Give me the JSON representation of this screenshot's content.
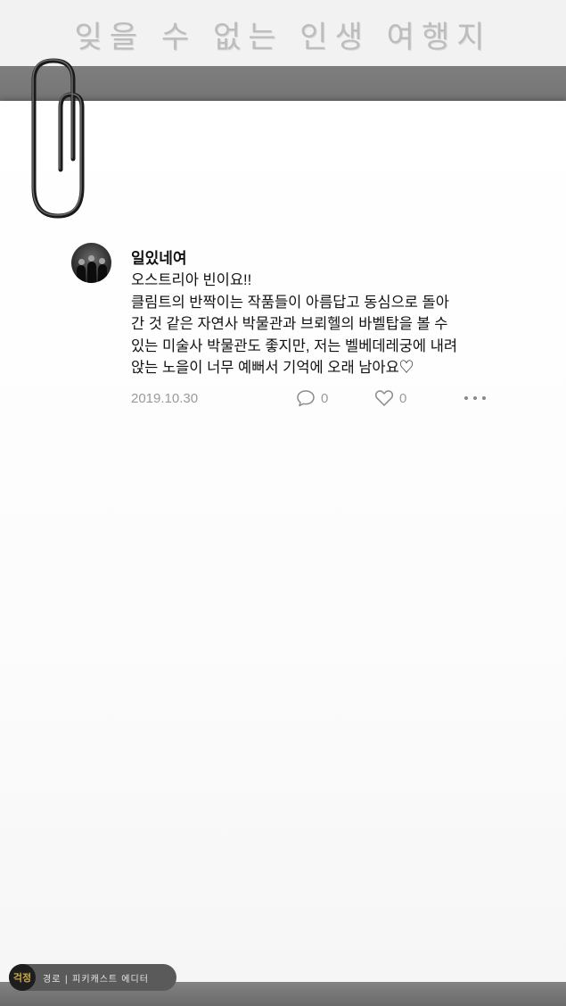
{
  "page": {
    "title": "잊을 수 없는 인생 여행지"
  },
  "post": {
    "username": "일있네여",
    "lines": [
      "오스트리아 빈이요!!",
      "클림트의 반짝이는 작품들이 아름답고 동심으로 돌아",
      "간 것 같은 자연사 박물관과 브뢰헬의 바벨탑을 볼 수",
      "있는 미술사 박물관도 좋지만, 저는 벨베데레궁에 내려",
      "앉는 노을이 너무 예뻐서 기억에 오래 남아요♡"
    ],
    "date": "2019.10.30",
    "comment_count": "0",
    "like_count": "0"
  },
  "watermark": {
    "logo": "걱정",
    "text": "경로 | 피키캐스트 에디터"
  },
  "icons": {
    "comment": "speech-bubble-icon",
    "like": "heart-icon",
    "more": "more-dots-icon",
    "clip": "paperclip-icon"
  },
  "colors": {
    "band": "#757575",
    "paper": "#ffffff",
    "meta": "#9a9a9a"
  }
}
